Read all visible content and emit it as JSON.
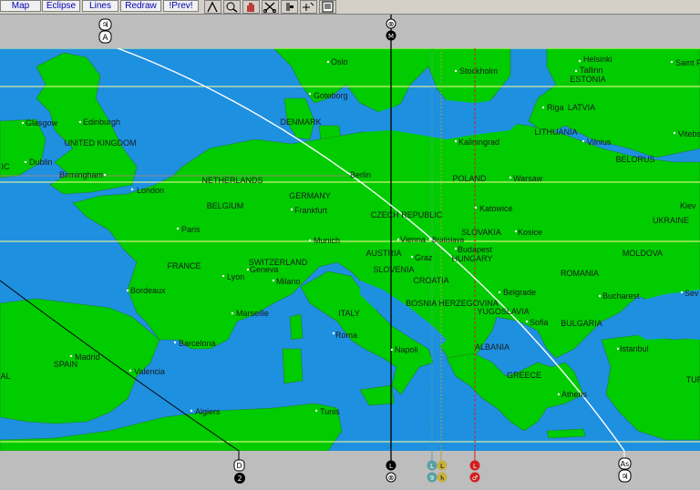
{
  "toolbar": {
    "buttons": [
      {
        "label": "Map"
      },
      {
        "label": "Eclipse"
      },
      {
        "label": "Lines"
      },
      {
        "label": "Redraw"
      },
      {
        "label": "!Prev!"
      }
    ],
    "tools": [
      "line-tool-icon",
      "zoom-tool-icon",
      "hand-pan-icon",
      "scissors-icon",
      "marker-tool-icon",
      "plus-cursor-icon",
      "print-icon"
    ]
  },
  "colors": {
    "land": "#00cc00",
    "sea": "#1e90e0",
    "band": "#bdbdbd",
    "parallel": "#ffff99",
    "curve": "#ffffff"
  },
  "cities": [
    "Oslo",
    "Stockholm",
    "Helsinki",
    "Tallinn",
    "Saint P",
    "Goteborg",
    "Riga",
    "Glasgow",
    "Edinburgh",
    "Dublin",
    "Kaliningrad",
    "Vilnius",
    "Vitebs",
    "Birmingham",
    "Berlin",
    "Warsaw",
    "London",
    "Frankfurt",
    "Katowice",
    "Kiev",
    "Paris",
    "Munich",
    "Vienna",
    "Bratislava",
    "Kosice",
    "Budapest",
    "Lyon",
    "Geneva",
    "Graz",
    "Milano",
    "Bordeaux",
    "Belgrade",
    "Bucharest",
    "Marseille",
    "Sofia",
    "Roma",
    "Napoli",
    "Barcelona",
    "Istanbul",
    "Madrid",
    "Valencia",
    "Athens",
    "Algiers",
    "Tunis",
    "Sev"
  ],
  "countries": [
    "ESTONIA",
    "LATVIA",
    "DENMARK",
    "LITHUANIA",
    "UNITED KINGDOM",
    "BELORUS",
    "NETHERLANDS",
    "POLAND",
    "GERMANY",
    "BELGIUM",
    "CZECH REPUBLIC",
    "SLOVAKIA",
    "UKRAINE",
    "AUSTRIA",
    "HUNGARY",
    "MOLDOVA",
    "FRANCE",
    "SWITZERLAND",
    "SLOVENIA",
    "CROATIA",
    "ROMANIA",
    "BOSNIA HERZEGOVINA",
    "YUGOSLAVIA",
    "BULGARIA",
    "ITALY",
    "ALBANIA",
    "SPAIN",
    "GREECE",
    "TUR",
    "IC",
    "AL"
  ],
  "glyphs": {
    "curve_top": [
      "♃",
      "A"
    ],
    "line_top": [
      "⊗",
      "M"
    ],
    "curve_bottom": [
      "As",
      "♃"
    ],
    "line_bottom": [
      "D",
      "2"
    ],
    "line2_bottom": [
      "L",
      "⊗"
    ],
    "teal_bottom": [
      "L",
      "9"
    ],
    "olive_bottom": [
      "L",
      "♄"
    ],
    "red_bottom": [
      "L",
      "♂"
    ]
  }
}
